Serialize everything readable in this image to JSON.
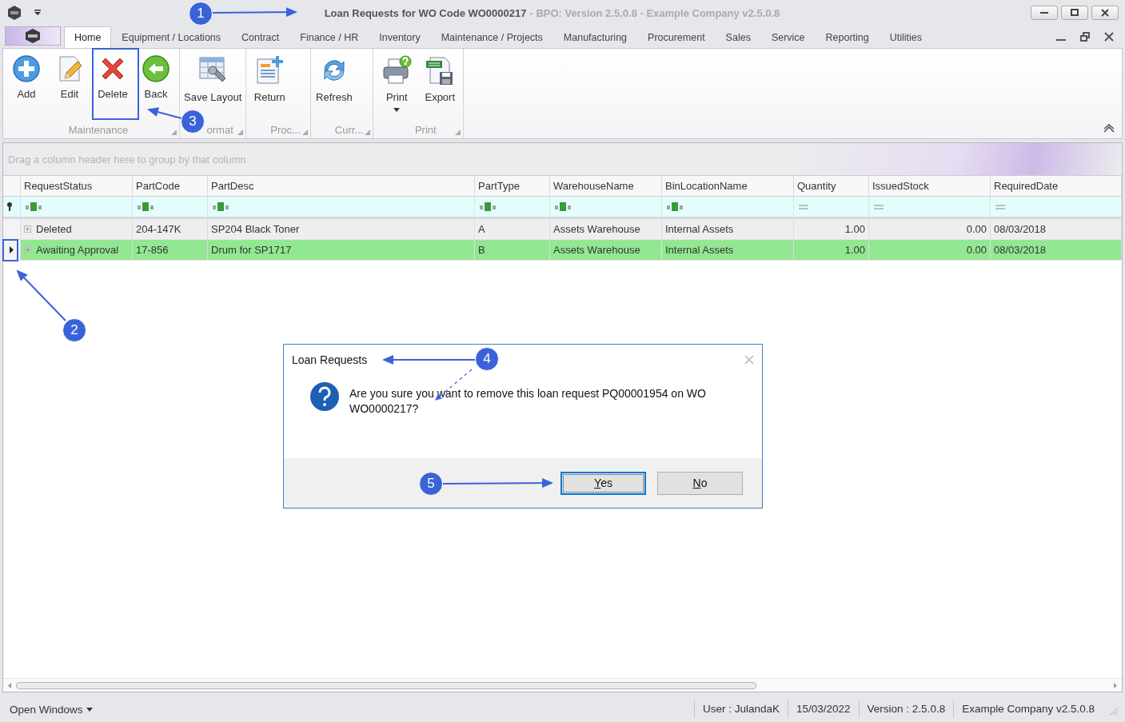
{
  "window": {
    "title": "Loan Requests for WO Code WO0000217",
    "subtitle": "- BPO: Version 2.5.0.8 - Example Company v2.5.0.8"
  },
  "tabs": [
    {
      "label": "Home",
      "selected": true
    },
    {
      "label": "Equipment / Locations",
      "selected": false
    },
    {
      "label": "Contract",
      "selected": false
    },
    {
      "label": "Finance / HR",
      "selected": false
    },
    {
      "label": "Inventory",
      "selected": false
    },
    {
      "label": "Maintenance / Projects",
      "selected": false
    },
    {
      "label": "Manufacturing",
      "selected": false
    },
    {
      "label": "Procurement",
      "selected": false
    },
    {
      "label": "Sales",
      "selected": false
    },
    {
      "label": "Service",
      "selected": false
    },
    {
      "label": "Reporting",
      "selected": false
    },
    {
      "label": "Utilities",
      "selected": false
    }
  ],
  "ribbon": {
    "groups": [
      {
        "label": "Maintenance",
        "buttons": [
          {
            "label": "Add",
            "kind": "add"
          },
          {
            "label": "Edit",
            "kind": "edit"
          },
          {
            "label": "Delete",
            "kind": "delete"
          },
          {
            "label": "Back",
            "kind": "back"
          }
        ]
      },
      {
        "label": "ormat",
        "buttons": [
          {
            "label": "Save Layout",
            "kind": "layout"
          }
        ]
      },
      {
        "label": "Proc...",
        "buttons": [
          {
            "label": "Return",
            "kind": "return"
          }
        ]
      },
      {
        "label": "Curr...",
        "buttons": [
          {
            "label": "Refresh",
            "kind": "refresh"
          }
        ]
      },
      {
        "label": "Print",
        "buttons": [
          {
            "label": "Print",
            "kind": "print",
            "dropdown": true
          },
          {
            "label": "Export",
            "kind": "export"
          }
        ]
      }
    ]
  },
  "grid": {
    "group_hint": "Drag a column header here to group by that column",
    "columns": [
      {
        "label": "RequestStatus",
        "kind": "text"
      },
      {
        "label": "PartCode",
        "kind": "text"
      },
      {
        "label": "PartDesc",
        "kind": "text"
      },
      {
        "label": "PartType",
        "kind": "text"
      },
      {
        "label": "WarehouseName",
        "kind": "text"
      },
      {
        "label": "BinLocationName",
        "kind": "text"
      },
      {
        "label": "Quantity",
        "kind": "number"
      },
      {
        "label": "IssuedStock",
        "kind": "number"
      },
      {
        "label": "RequiredDate",
        "kind": "date"
      }
    ],
    "rows": [
      {
        "selected": false,
        "cells": [
          "Deleted",
          "204-147K",
          "SP204 Black Toner",
          "A",
          "Assets Warehouse",
          "Internal Assets",
          "1.00",
          "0.00",
          "08/03/2018"
        ]
      },
      {
        "selected": true,
        "cells": [
          "Awaiting Approval",
          "17-856",
          "Drum for SP1717",
          "B",
          "Assets Warehouse",
          "Internal Assets",
          "1.00",
          "0.00",
          "08/03/2018"
        ]
      }
    ]
  },
  "dialog": {
    "title": "Loan Requests",
    "message": "Are you sure you want to remove this loan request PQ00001954 on WO WO0000217?",
    "buttons": [
      {
        "label": "Yes",
        "selected": true
      },
      {
        "label": "No",
        "selected": false
      }
    ]
  },
  "status_bar": {
    "menu": "Open Windows",
    "items": [
      "User : JulandaK",
      "15/03/2022",
      "Version : 2.5.0.8",
      "Example Company v2.5.0.8"
    ]
  },
  "annotations": [
    {
      "label": "1"
    },
    {
      "label": "2"
    },
    {
      "label": "3"
    },
    {
      "label": "4"
    },
    {
      "label": "5"
    }
  ]
}
